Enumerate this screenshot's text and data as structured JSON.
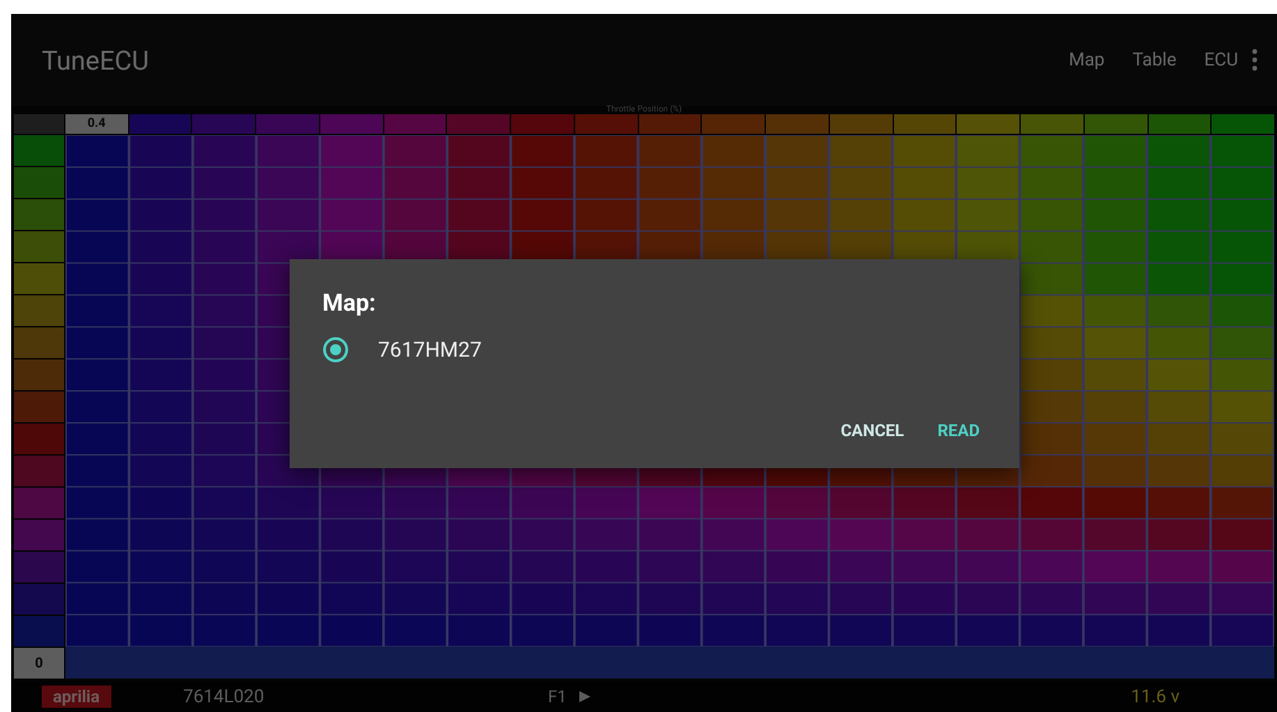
{
  "app_bar": {
    "title": "TuneECU",
    "actions": [
      "Map",
      "Table",
      "ECU"
    ]
  },
  "map_table": {
    "axis_label": "Throttle Position (%)",
    "first_column_header": "0.4",
    "last_row_header": "0"
  },
  "dialog": {
    "title": "Map:",
    "options": [
      {
        "label": "7617HM27",
        "selected": true
      }
    ],
    "buttons": [
      "CANCEL",
      "READ"
    ]
  },
  "status_bar": {
    "brand": "aprilia",
    "map_id": "7614L020",
    "page": "F1",
    "voltage": "11.6 v"
  }
}
